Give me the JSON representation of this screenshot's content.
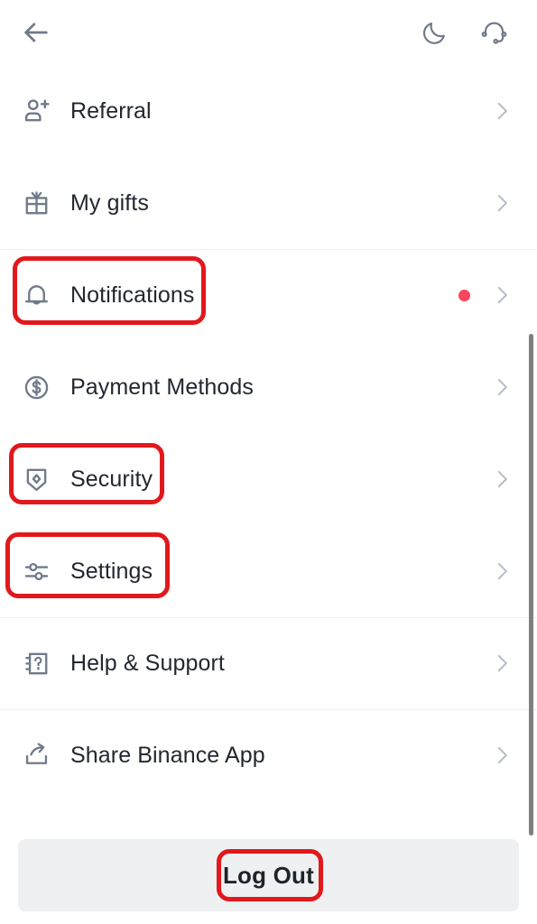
{
  "header": {
    "back_icon": "arrow-left-icon",
    "actions": [
      {
        "icon": "moon-icon",
        "name": "dark-mode-toggle"
      },
      {
        "icon": "headset-icon",
        "name": "customer-support"
      }
    ]
  },
  "menu": {
    "items": [
      {
        "label": "Referral",
        "icon": "user-plus-icon",
        "chevron": "chevron-right-icon",
        "badge": false,
        "divider_above": false,
        "highlighted": false
      },
      {
        "label": "My gifts",
        "icon": "gift-icon",
        "chevron": "chevron-right-icon",
        "badge": false,
        "divider_above": false,
        "highlighted": false
      },
      {
        "label": "Notifications",
        "icon": "bell-icon",
        "chevron": "chevron-right-icon",
        "badge": true,
        "divider_above": true,
        "highlighted": true
      },
      {
        "label": "Payment Methods",
        "icon": "dollar-circle-icon",
        "chevron": "chevron-right-icon",
        "badge": false,
        "divider_above": false,
        "highlighted": false
      },
      {
        "label": "Security",
        "icon": "shield-icon",
        "chevron": "chevron-right-icon",
        "badge": false,
        "divider_above": false,
        "highlighted": true
      },
      {
        "label": "Settings",
        "icon": "sliders-icon",
        "chevron": "chevron-right-icon",
        "badge": false,
        "divider_above": false,
        "highlighted": true
      },
      {
        "label": "Help & Support",
        "icon": "help-book-icon",
        "chevron": "chevron-right-icon",
        "badge": false,
        "divider_above": true,
        "highlighted": false
      },
      {
        "label": "Share Binance App",
        "icon": "share-icon",
        "chevron": "chevron-right-icon",
        "badge": false,
        "divider_above": true,
        "highlighted": false
      }
    ]
  },
  "logout": {
    "label": "Log Out",
    "highlighted": true
  },
  "colors": {
    "highlight_box": "#E2181C",
    "badge_dot": "#F6465D",
    "icon_gray": "#707A8A",
    "text": "#232730",
    "divider": "#ECEEF0",
    "logout_bg": "#EEF0F2",
    "scrollbar": "#808080"
  }
}
